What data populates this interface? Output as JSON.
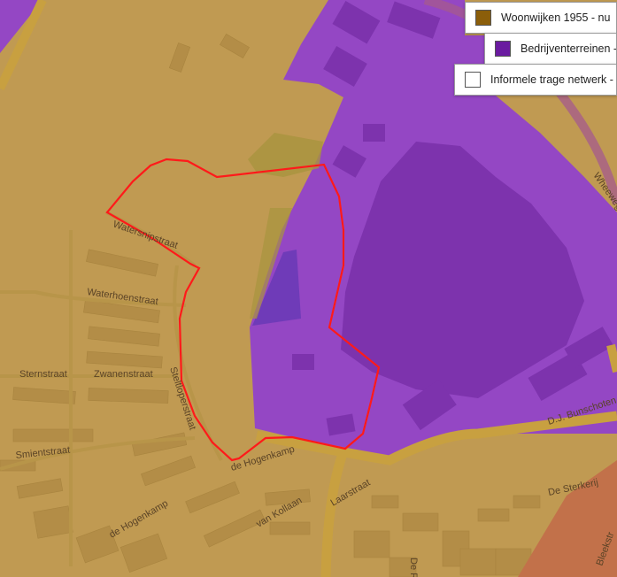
{
  "legend": {
    "items": [
      {
        "label": "Woonwijken 1955 - nu",
        "color": "#8b5e0a"
      },
      {
        "label": "Bedrijventerreinen -",
        "color": "#6a1ba0"
      },
      {
        "label": "Informele trage netwerk -",
        "color": "#ffffff"
      }
    ]
  },
  "streets": {
    "watersnipstraat": "Watersnipstraat",
    "waterhoenstraat": "Waterhoenstraat",
    "sternstraat": "Sternstraat",
    "zwanenstraat": "Zwanenstraat",
    "steltloperstraat": "Steltloperstraat",
    "smientstraat": "Smientstraat",
    "de_hogenkamp_1": "de Hogenkamp",
    "de_hogenkamp_2": "de Hogenkamp",
    "van_kollaan": "van Kollaan",
    "laarstraat": "Laarstraat",
    "bunschoten": "D.J. Bunschoten",
    "de_sterkerij": "De Sterkerij",
    "wheeweg": "Wheeweg",
    "bleekstraat": "Bleekstr",
    "de_r": "De R"
  },
  "colors": {
    "residential": "#c09a52",
    "industrial": "#9447c4",
    "industrial_dark": "#7d33ad",
    "boundary": "#ff1a1a",
    "road": "#c8a040",
    "red_zone": "#c2714a"
  }
}
